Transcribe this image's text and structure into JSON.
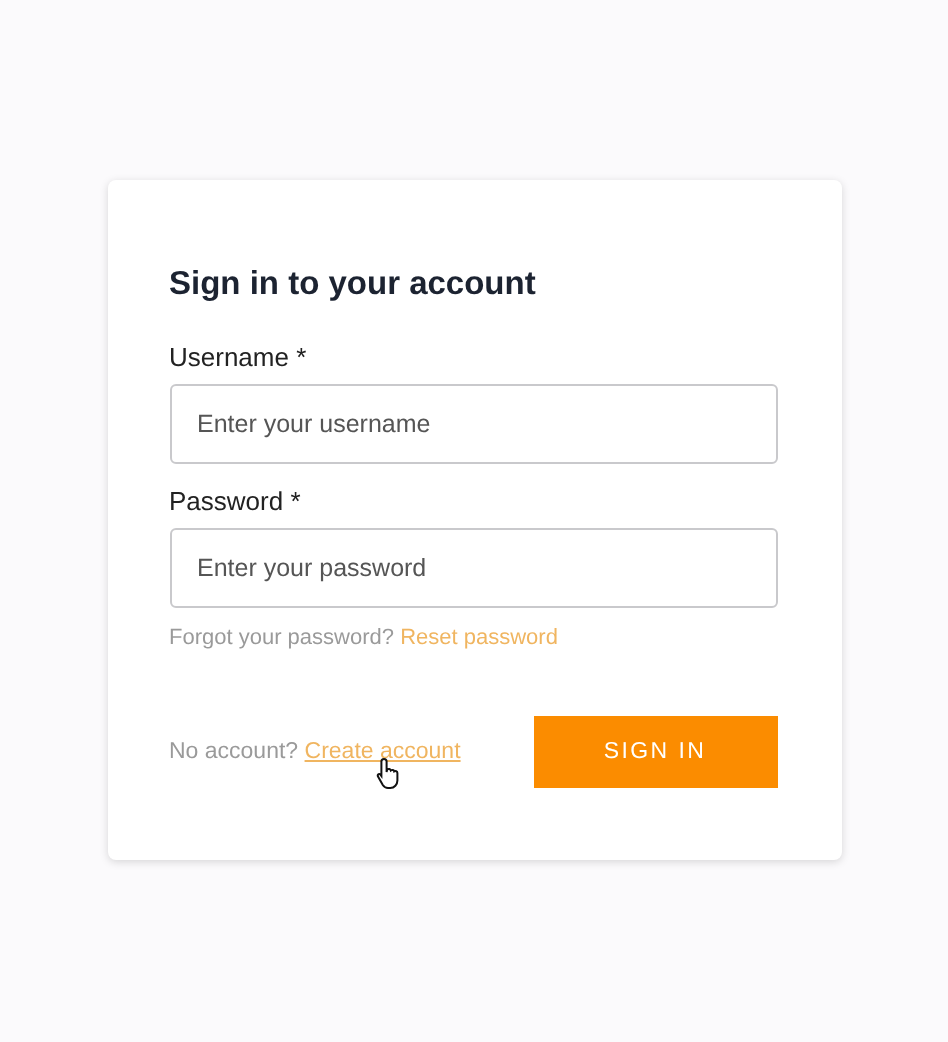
{
  "title": "Sign in to your account",
  "fields": [
    {
      "label": "Username *",
      "placeholder": "Enter your username"
    },
    {
      "label": "Password *",
      "placeholder": "Enter your password"
    }
  ],
  "forgot": {
    "text": "Forgot your password?",
    "link": "Reset password"
  },
  "signup": {
    "text": "No account?",
    "link": "Create account",
    "hovered": true
  },
  "submit": "SIGN IN"
}
